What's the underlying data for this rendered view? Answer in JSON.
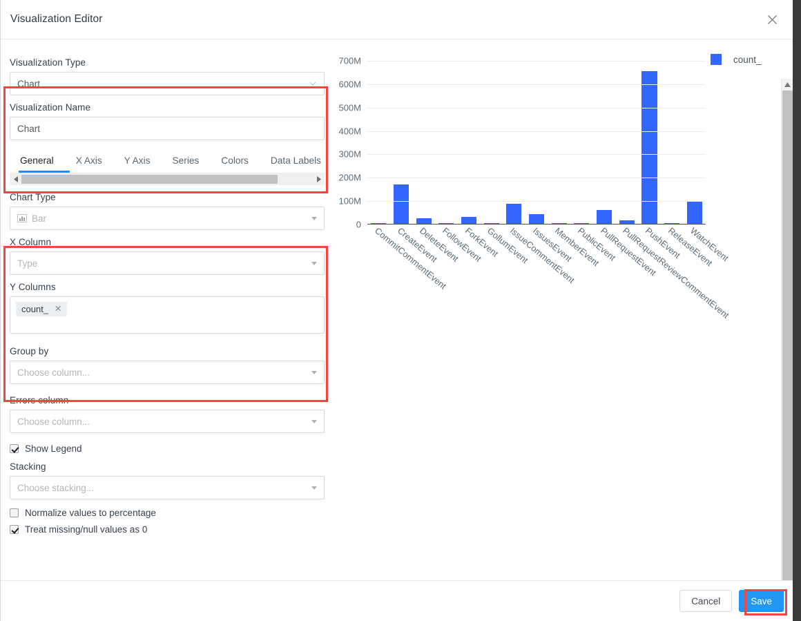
{
  "header": {
    "title": "Visualization Editor",
    "close_icon": "close-icon"
  },
  "left_panel": {
    "visualization_type": {
      "label": "Visualization Type",
      "value": "Chart",
      "icon": "chevron-down-icon"
    },
    "visualization_name": {
      "label": "Visualization Name",
      "value": "Chart"
    },
    "tabs": [
      {
        "label": "General",
        "active": true
      },
      {
        "label": "X Axis",
        "active": false
      },
      {
        "label": "Y Axis",
        "active": false
      },
      {
        "label": "Series",
        "active": false
      },
      {
        "label": "Colors",
        "active": false
      },
      {
        "label": "Data Labels",
        "active": false
      }
    ],
    "tab_scrollbar": {
      "left_arrow_icon": "caret-left-icon",
      "right_arrow_icon": "caret-right-icon"
    },
    "chart_type": {
      "label": "Chart Type",
      "value": "Bar",
      "icon": "bar-chart-icon",
      "caret_icon": "caret-down-icon"
    },
    "x_column": {
      "label": "X Column",
      "placeholder": "Type",
      "value": "",
      "caret_icon": "caret-down-icon"
    },
    "y_columns": {
      "label": "Y Columns",
      "chips": [
        {
          "label": "count_",
          "remove_icon": "close-icon"
        }
      ]
    },
    "group_by": {
      "label": "Group by",
      "placeholder": "Choose column...",
      "caret_icon": "caret-down-icon"
    },
    "errors_column": {
      "label": "Errors column",
      "placeholder": "Choose column...",
      "caret_icon": "caret-down-icon"
    },
    "show_legend": {
      "label": "Show Legend",
      "checked": true
    },
    "stacking": {
      "label": "Stacking",
      "placeholder": "Choose stacking...",
      "caret_icon": "caret-down-icon"
    },
    "normalize": {
      "label": "Normalize values to percentage",
      "checked": false
    },
    "treat_missing": {
      "label": "Treat missing/null values as 0",
      "checked": true
    }
  },
  "footer": {
    "cancel_label": "Cancel",
    "save_label": "Save"
  },
  "colors": {
    "bar": "#3366ff",
    "highlight": "#f4453c",
    "primary": "#2196f3",
    "tab_active_underline": "#1890ff"
  },
  "chart_data": {
    "type": "bar",
    "title": "",
    "xlabel": "",
    "ylabel": "",
    "legend": [
      "count_"
    ],
    "legend_position": "right",
    "grid": true,
    "ylim": [
      0,
      750000000
    ],
    "ytick_labels": [
      "0",
      "100M",
      "200M",
      "300M",
      "400M",
      "500M",
      "600M",
      "700M"
    ],
    "ytick_values": [
      0,
      100000000,
      200000000,
      300000000,
      400000000,
      500000000,
      600000000,
      700000000
    ],
    "categories": [
      "CommitCommentEvent",
      "CreateEvent",
      "DeleteEvent",
      "FollowEvent",
      "ForkEvent",
      "GollumEvent",
      "IssueCommentEvent",
      "IssuesEvent",
      "MemberEvent",
      "PublicEvent",
      "PullRequestEvent",
      "PullRequestReviewCommentEvent",
      "PushEvent",
      "ReleaseEvent",
      "WatchEvent"
    ],
    "series": [
      {
        "name": "count_",
        "color": "#3366ff",
        "values": [
          5000000,
          172000000,
          28000000,
          1000000,
          33000000,
          5000000,
          88000000,
          43000000,
          4000000,
          1500000,
          62000000,
          17000000,
          655000000,
          3000000,
          97000000
        ]
      }
    ]
  }
}
